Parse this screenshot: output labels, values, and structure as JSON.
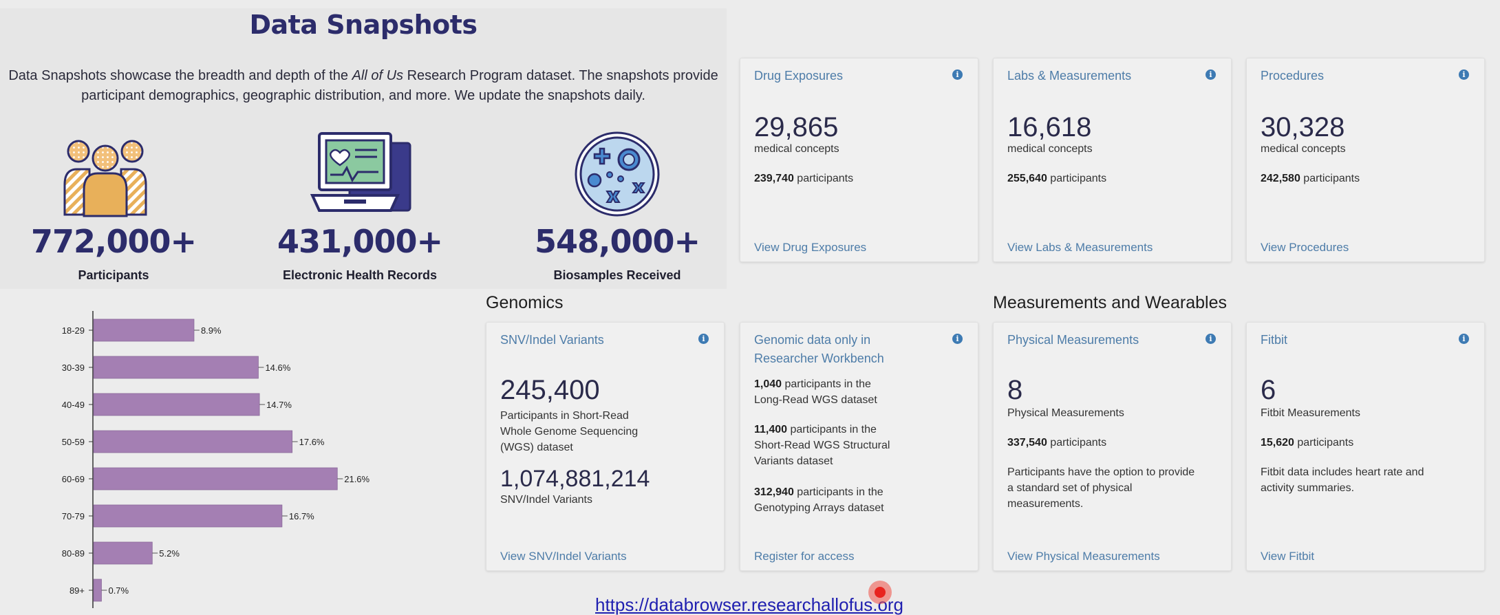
{
  "hero": {
    "title": "Data Snapshots",
    "desc_pre": "Data Snapshots showcase the breadth and depth of the ",
    "desc_italic": "All of Us",
    "desc_post": " Research Program dataset. The snapshots provide participant demographics, geographic distribution, and more. We update the snapshots daily.",
    "stats": [
      {
        "value": "772,000+",
        "label": "Participants",
        "icon": "participants-icon"
      },
      {
        "value": "431,000+",
        "label": "Electronic Health Records",
        "icon": "laptop-health-icon"
      },
      {
        "value": "548,000+",
        "label": "Biosamples Received",
        "icon": "petri-dish-icon"
      }
    ]
  },
  "top_cards": [
    {
      "title": "Drug Exposures",
      "count": "29,865",
      "count_label": "medical concepts",
      "participants_num": "239,740",
      "participants_word": "participants",
      "link": "View Drug Exposures"
    },
    {
      "title": "Labs & Measurements",
      "count": "16,618",
      "count_label": "medical concepts",
      "participants_num": "255,640",
      "participants_word": "participants",
      "link": "View Labs & Measurements"
    },
    {
      "title": "Procedures",
      "count": "30,328",
      "count_label": "medical concepts",
      "participants_num": "242,580",
      "participants_word": "participants",
      "link": "View Procedures"
    }
  ],
  "sections": {
    "genomics": "Genomics",
    "measurements": "Measurements and Wearables"
  },
  "snv_card": {
    "title": "SNV/Indel Variants",
    "count1": "245,400",
    "count1_label_lines": [
      "Participants in Short-Read",
      "Whole Genome Sequencing",
      "(WGS) dataset"
    ],
    "count2": "1,074,881,214",
    "count2_label": "SNV/Indel Variants",
    "link": "View SNV/Indel Variants"
  },
  "genomic_rw_card": {
    "title_lines": [
      "Genomic data only in",
      "Researcher Workbench"
    ],
    "items": [
      {
        "num": "1,040",
        "lines": [
          " participants in the",
          "Long-Read WGS dataset"
        ]
      },
      {
        "num": "11,400",
        "lines": [
          " participants in the",
          "Short-Read WGS Structural",
          "Variants dataset"
        ]
      },
      {
        "num": "312,940",
        "lines": [
          " participants in the",
          "Genotyping Arrays dataset"
        ]
      }
    ],
    "link": "Register for access"
  },
  "physical_card": {
    "title": "Physical Measurements",
    "count": "8",
    "count_label": "Physical Measurements",
    "participants_num": "337,540",
    "participants_word": "participants",
    "desc_lines": [
      "Participants have the option to provide",
      "a standard set of physical",
      "measurements."
    ],
    "link": "View Physical Measurements"
  },
  "fitbit_card": {
    "title": "Fitbit",
    "count": "6",
    "count_label": "Fitbit Measurements",
    "participants_num": "15,620",
    "participants_word": "participants",
    "desc_lines": [
      "Fitbit data includes heart rate and",
      "activity summaries."
    ],
    "link": "View Fitbit"
  },
  "info_glyph": "i",
  "chart_data": {
    "type": "bar",
    "orientation": "horizontal",
    "categories": [
      "18-29",
      "30-39",
      "40-49",
      "50-59",
      "60-69",
      "70-79",
      "80-89",
      "89+"
    ],
    "values": [
      8.9,
      14.6,
      14.7,
      17.6,
      21.6,
      16.7,
      5.2,
      0.7
    ],
    "value_labels": [
      "8.9%",
      "14.6%",
      "14.7%",
      "17.6%",
      "21.6%",
      "16.7%",
      "5.2%",
      "0.7%"
    ],
    "bar_color": "#a47fb3",
    "xlim": [
      0,
      25
    ]
  },
  "footer": {
    "url": "https://databrowser.researchallofus.org"
  },
  "colors": {
    "title": "#2c2c6b",
    "link": "#4d7ca8",
    "accent_orange": "#e8b05a",
    "bar": "#a47fb3"
  }
}
